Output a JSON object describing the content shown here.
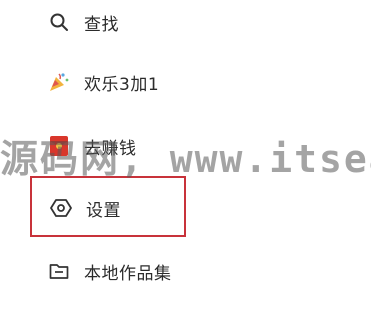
{
  "menu": {
    "items": [
      {
        "label": "查找",
        "icon": "search-icon"
      },
      {
        "label": "欢乐3加1",
        "icon": "party-popper-icon"
      },
      {
        "label": "去赚钱",
        "icon": "red-envelope-icon"
      },
      {
        "label": "设置",
        "icon": "settings-hexagon-icon"
      },
      {
        "label": "本地作品集",
        "icon": "folder-icon"
      }
    ]
  },
  "watermark": {
    "text": "源码网, www.itsear"
  },
  "colors": {
    "highlight_border": "#c8323a",
    "text": "#2b2b2b",
    "icon": "#333333",
    "envelope": "#d9362b"
  }
}
